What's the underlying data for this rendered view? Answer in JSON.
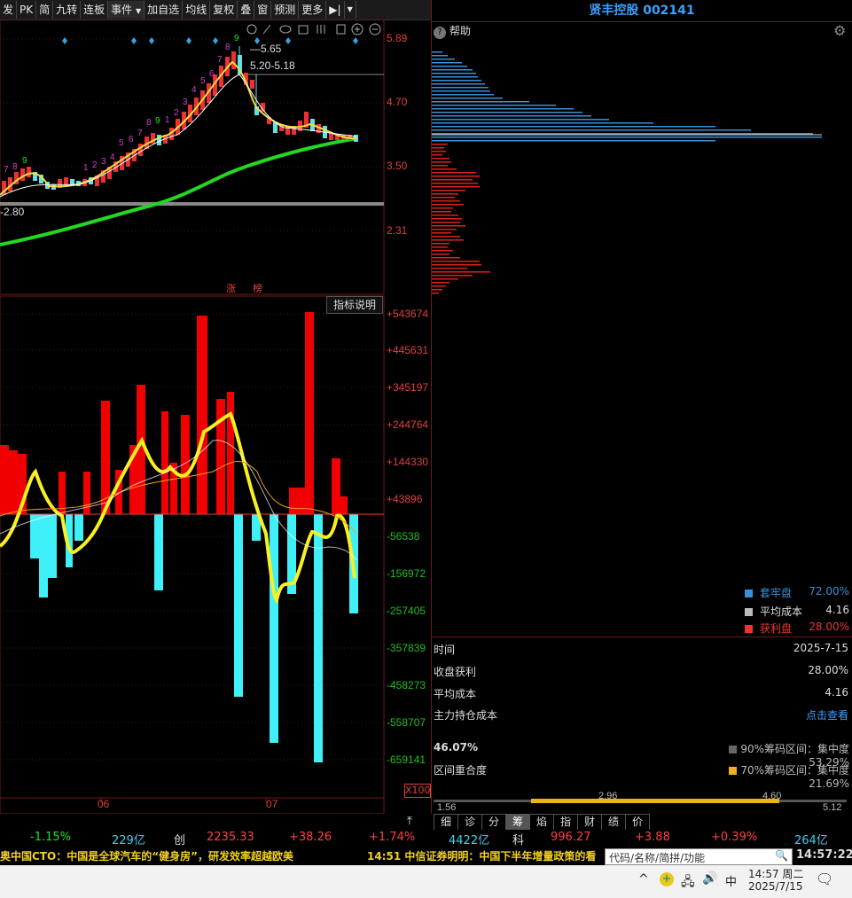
{
  "toolbar": {
    "items": [
      "发",
      "PK",
      "简",
      "九转",
      "连板",
      "事件",
      "加自选",
      "均线",
      "复权",
      "叠",
      "窗",
      "预测",
      "更多"
    ]
  },
  "stock": {
    "title": "贤丰控股 002141"
  },
  "help_label": "帮助",
  "price_axis": [
    "5.89",
    "4.70",
    "3.50",
    "2.31"
  ],
  "annotations": {
    "high": "5.65",
    "range": "5.20-5.18",
    "low": "2.80",
    "zhang": "涨",
    "bang": "榜"
  },
  "td_counts": {
    "left": [
      "7",
      "8",
      "9"
    ],
    "mid": [
      "1",
      "2",
      "3",
      "4",
      "5",
      "6",
      "7",
      "8",
      "9"
    ],
    "top": [
      "1",
      "2",
      "3",
      "4",
      "5",
      "6",
      "7",
      "8",
      "9"
    ]
  },
  "indicator_label": "指标说明",
  "vol_axis": [
    "+543674",
    "+445631",
    "+345197",
    "+244764",
    "+144330",
    "+43896",
    "-56538",
    "-156972",
    "-257405",
    "-357839",
    "-458273",
    "-558707",
    "-659141"
  ],
  "x100": "X100",
  "date_labels": [
    "06",
    "07"
  ],
  "chip_legend": [
    {
      "label": "套牢盘",
      "value": "72.00%",
      "color": "#3a8fd6"
    },
    {
      "label": "平均成本",
      "value": "4.16",
      "color": "#bbbbbb"
    },
    {
      "label": "获利盘",
      "value": "28.00%",
      "color": "#ee3333"
    }
  ],
  "info": {
    "time_label": "时间",
    "time_value": "2025-7-15",
    "profit_label": "收盘获利",
    "profit_value": "28.00%",
    "avg_label": "平均成本",
    "avg_value": "4.16",
    "main_label": "主力持仓成本",
    "main_value": "点击查看",
    "overlap_pct": "46.07%",
    "overlap_label": "区间重合度",
    "r90": "90%筹码区间：集中度53.29%",
    "r70": "70%筹码区间：集中度21.69%"
  },
  "range_bar": {
    "min": "1.56",
    "l90": "2.96",
    "l70": "4.60",
    "max": "5.12"
  },
  "bottom_tabs": [
    "细",
    "诊",
    "分",
    "筹",
    "焰",
    "指",
    "财",
    "绩",
    "价"
  ],
  "quote_bar": {
    "a": "-1.15%",
    "b": "229亿",
    "c": "创",
    "d": "2235.33",
    "e": "+38.26",
    "f": "+1.74%",
    "g": "4422亿",
    "h": "科",
    "i": "996.27",
    "j": "+3.88",
    "k": "+0.39%",
    "l": "264亿"
  },
  "news": {
    "left": "奥中国CTO：中国是全球汽车的“健身房”，研发效率超越欧美",
    "right": "14:51 中信证券明明：中国下半年增量政策的看",
    "search_placeholder": "代码/名称/简拼/功能",
    "clock": "14:57:22"
  },
  "taskbar": {
    "ime": "中",
    "time": "14:57 周二",
    "date": "2025/7/15"
  }
}
